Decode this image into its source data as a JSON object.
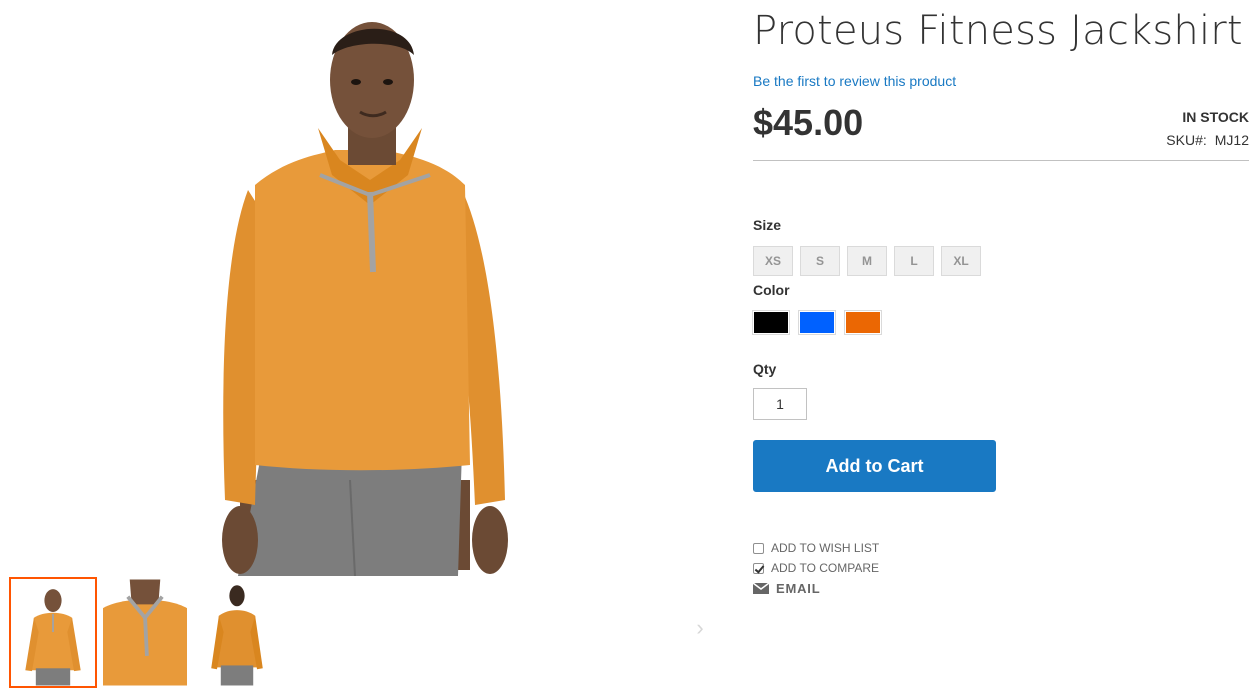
{
  "product": {
    "title": "Proteus Fitness Jackshirt",
    "review_link": "Be the first to review this product",
    "price": "$45.00",
    "stock_status": "In stock",
    "sku_label": "SKU#:",
    "sku_value": "MJ12"
  },
  "options": {
    "size_label": "Size",
    "sizes": [
      "XS",
      "S",
      "M",
      "L",
      "XL"
    ],
    "color_label": "Color",
    "colors": [
      {
        "name": "Black",
        "hex": "#000000"
      },
      {
        "name": "Blue",
        "hex": "#0061ff"
      },
      {
        "name": "Orange",
        "hex": "#eb6703"
      }
    ]
  },
  "qty": {
    "label": "Qty",
    "value": "1"
  },
  "actions": {
    "add_to_cart": "Add to Cart",
    "wishlist": "Add to Wish List",
    "compare": "Add to Compare",
    "email": "Email"
  },
  "gallery": {
    "thumbnails": [
      {
        "icon": "product-front-thumbnail",
        "active": true
      },
      {
        "icon": "product-closeup-thumbnail",
        "active": false
      },
      {
        "icon": "product-back-thumbnail",
        "active": false
      }
    ],
    "next_icon": "chevron-right-icon",
    "prev_icon": "chevron-left-icon"
  },
  "colors": {
    "accent": "#1979c3",
    "active_thumb_border": "#ff5501",
    "shirt": "#e89a3a",
    "shorts": "#7d7d7d"
  }
}
